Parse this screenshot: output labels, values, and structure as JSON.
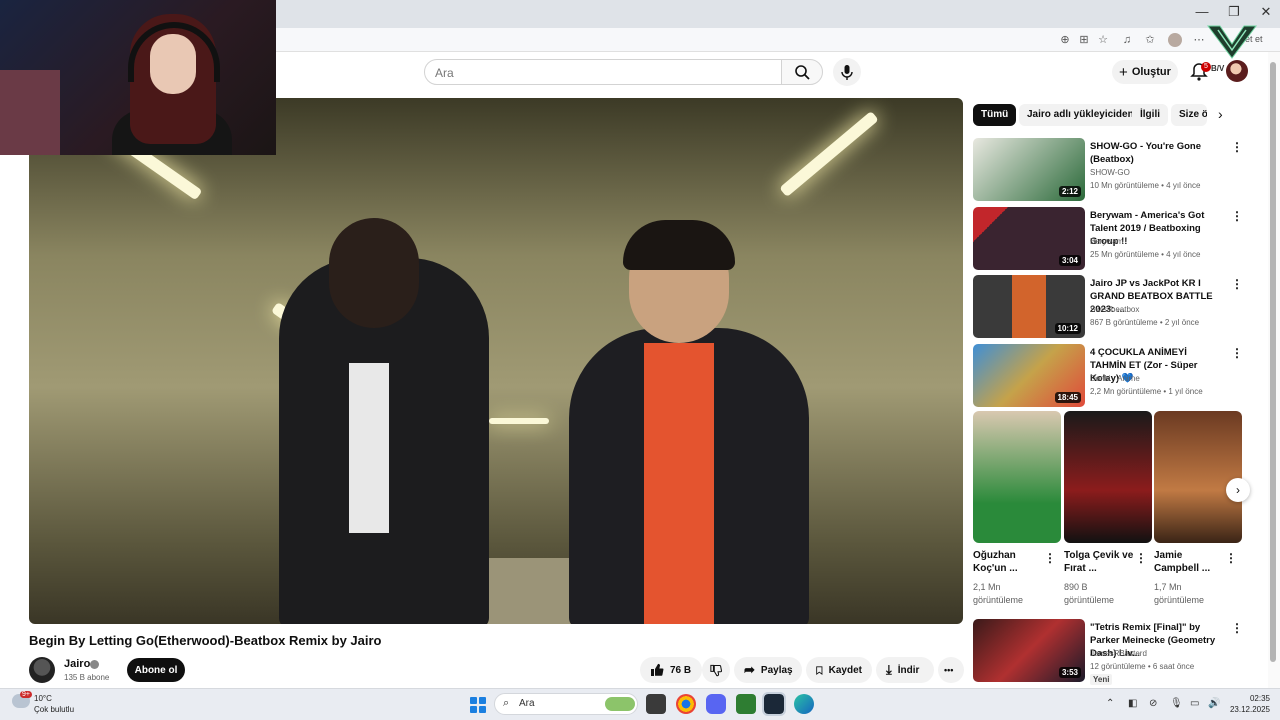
{
  "browser": {
    "window_controls": {
      "minimize": "—",
      "restore": "❐",
      "close": "✕"
    },
    "toolbar_icons": [
      "translate-icon",
      "grid-icon",
      "star-icon",
      "media-icon",
      "favorites-icon",
      "collections-icon",
      "profile-icon",
      "more-icon"
    ]
  },
  "header": {
    "search_placeholder": "Ara",
    "create_label": "Oluştur",
    "notification_count": "5",
    "corner_text": "bet et",
    "logo_text": "B/V"
  },
  "video": {
    "title": "Begin By Letting Go(Etherwood)-Beatbox Remix by Jairo",
    "channel": "Jairo",
    "subscribers": "135 B abone",
    "subscribe_label": "Abone ol",
    "likes": "76 B",
    "share_label": "Paylaş",
    "save_label": "Kaydet",
    "download_label": "İndir",
    "more_label": "•••"
  },
  "chips": [
    "Tümü",
    "Jairo adlı yükleyiciden",
    "İlgili",
    "Size ö"
  ],
  "recommendations": [
    {
      "title": "SHOW-GO - You're Gone (Beatbox)",
      "channel": "SHOW-GO",
      "meta": "10 Mn görüntüleme • 4 yıl önce",
      "duration": "2:12",
      "thumb_color": "#2b6a3a"
    },
    {
      "title": "Berywam - America's Got Talent 2019 / Beatboxing Group !!",
      "channel": "Berywam",
      "meta": "25 Mn görüntüleme • 4 yıl önce",
      "duration": "3:04",
      "thumb_color": "#3a2430"
    },
    {
      "title": "Jairo JP vs JackPot KR I GRAND BEATBOX BATTLE 2023: ...",
      "channel": "Swissbeatbox",
      "meta": "867 B görüntüleme • 2 yıl önce",
      "duration": "10:12",
      "thumb_color": "#d2642c"
    },
    {
      "title": "4 ÇOCUKLA ANİMEYİ TAHMİN ET (Zor - Süper Kolay) 💙",
      "channel": "Donki - Anime",
      "meta": "2,2 Mn görüntüleme • 1 yıl önce",
      "duration": "18:45",
      "thumb_color": "#c5a24a"
    }
  ],
  "shorts": [
    {
      "title": "Oğuzhan Koç'un ...",
      "views": "2,1 Mn görüntüleme",
      "color": "#2a8a3a"
    },
    {
      "title": "Tolga Çevik ve Fırat ...",
      "views": "890 B görüntüleme",
      "color": "#8c1c1c"
    },
    {
      "title": "Jamie Campbell ...",
      "views": "1,7 Mn görüntüleme",
      "color": "#c17a44"
    }
  ],
  "rec_bottom": {
    "title": "\"Tetris Remix [Final]\" by Parker Meinecke (Geometry Dash) Liv...",
    "channel": "JamesRBasterd",
    "meta": "12 görüntüleme • 6 saat önce",
    "duration": "3:53",
    "badge": "Yeni"
  },
  "taskbar": {
    "weather_badge": "9+",
    "temperature": "10°C",
    "condition": "Çok bulutlu",
    "search_placeholder": "Ara",
    "time": "02:35",
    "date": "23.12.2025"
  }
}
